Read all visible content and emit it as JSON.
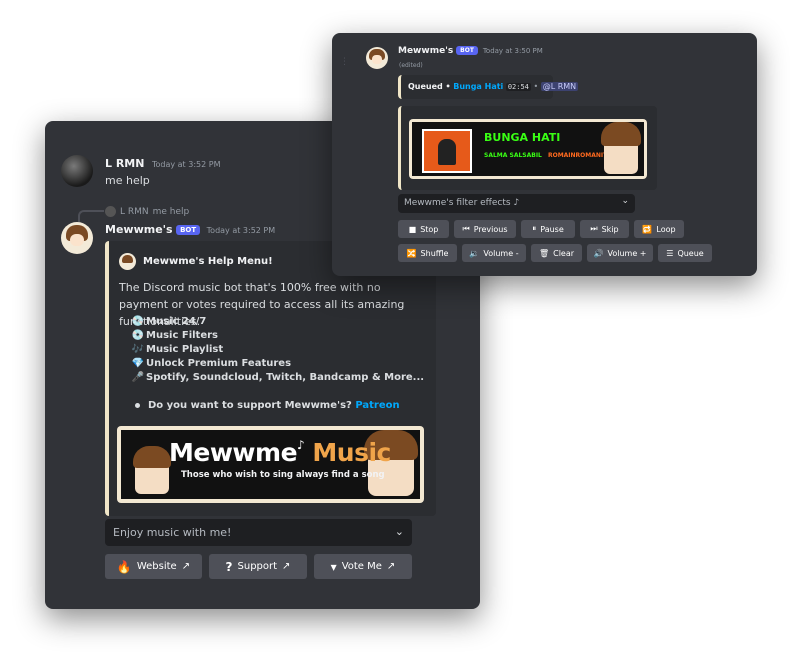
{
  "help_window": {
    "user_message": {
      "author": "L RMN",
      "timestamp": "Today at 3:52 PM",
      "content": "me help"
    },
    "reply_ref": {
      "author": "L RMN",
      "content": "me help"
    },
    "bot_message": {
      "author": "Mewwme's",
      "bot_tag": "BOT",
      "timestamp": "Today at 3:52 PM",
      "embed": {
        "title": "Mewwme's Help Menu!",
        "description": "The Discord music bot that's 100% free with no payment or votes required to access all its amazing functionalities.",
        "features": [
          {
            "icon": "cd-icon",
            "glyph": "💿",
            "label": "Music 24/7"
          },
          {
            "icon": "record-icon",
            "glyph": "💿",
            "label": "Music Filters"
          },
          {
            "icon": "playlist-icon",
            "glyph": "🎶",
            "label": "Music Playlist"
          },
          {
            "icon": "gem-icon",
            "glyph": "💎",
            "label": "Unlock Premium Features"
          },
          {
            "icon": "microphone-icon",
            "glyph": "🎤",
            "label": "Spotify, Soundcloud, Twitch, Bandcamp & More..."
          }
        ],
        "support_text": "Do you want to support Mewwme's?",
        "support_link": "Patreon",
        "banner": {
          "title_a": "Mewwme",
          "title_b": "Music",
          "subtitle": "Those who wish to sing always find a song"
        }
      },
      "select_placeholder": "Enjoy music with me!",
      "buttons": [
        {
          "label": "Website",
          "icon": "website-icon"
        },
        {
          "label": "Support",
          "icon": "question-icon"
        },
        {
          "label": "Vote Me",
          "icon": "vote-icon"
        }
      ]
    }
  },
  "player_window": {
    "author": "Mewwme's",
    "bot_tag": "BOT",
    "timestamp": "Today at 3:50 PM",
    "edited": "(edited)",
    "queued": {
      "label": "Queued •",
      "song": "Bunga Hati",
      "duration": "02:54",
      "separator": "•",
      "mention": "@L RMN"
    },
    "now_playing": {
      "title": "BUNGA HATI",
      "artist": "SALMA SALSABIL",
      "tags": "ROMAINROMANIYYA"
    },
    "select_placeholder": "Mewwme's filter effects ♪",
    "buttons_row1": [
      {
        "label": "Stop",
        "icon": "stop-icon",
        "glyph": "■"
      },
      {
        "label": "Previous",
        "icon": "previous-icon",
        "glyph": "⏮"
      },
      {
        "label": "Pause",
        "icon": "pause-icon",
        "glyph": "⏸"
      },
      {
        "label": "Skip",
        "icon": "skip-icon",
        "glyph": "⏭"
      },
      {
        "label": "Loop",
        "icon": "loop-icon",
        "glyph": "🔁"
      }
    ],
    "buttons_row2": [
      {
        "label": "Shuffle",
        "icon": "shuffle-icon",
        "glyph": "🔀"
      },
      {
        "label": "Volume -",
        "icon": "volume-down-icon",
        "glyph": "🔉"
      },
      {
        "label": "Clear",
        "icon": "trash-icon",
        "glyph": "🗑"
      },
      {
        "label": "Volume +",
        "icon": "volume-up-icon",
        "glyph": "🔊"
      },
      {
        "label": "Queue",
        "icon": "queue-icon",
        "glyph": "☰"
      }
    ]
  },
  "colors": {
    "window_bg": "#313338",
    "embed_bg": "#2b2d31",
    "button_bg": "#4e5058",
    "link": "#00a8fc",
    "accent_green": "#39ff14",
    "accent_orange": "#ff6a1f",
    "bot_tag": "#5865f2"
  }
}
